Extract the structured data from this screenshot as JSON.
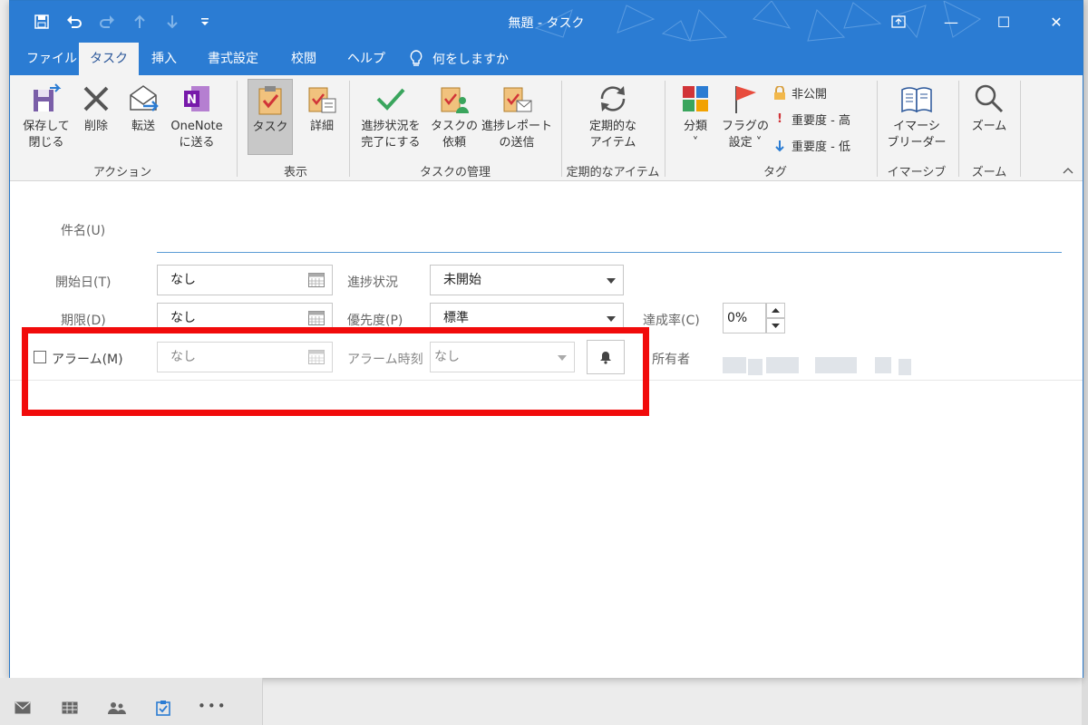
{
  "window": {
    "title": "無題 - タスク",
    "controls": {
      "restore_icon": "ribbon-display-icon",
      "minimize": "—",
      "maximize": "☐",
      "close": "✕"
    }
  },
  "qat": {
    "save_icon": "save-icon",
    "undo_icon": "undo-icon",
    "redo_icon": "redo-icon",
    "up_icon": "up-icon",
    "down_icon": "down-icon",
    "customize_icon": "customize-icon"
  },
  "tabs": [
    {
      "label": "ファイル"
    },
    {
      "label": "タスク"
    },
    {
      "label": "挿入"
    },
    {
      "label": "書式設定"
    },
    {
      "label": "校閲"
    },
    {
      "label": "ヘルプ"
    }
  ],
  "tell_me": "何をしますか",
  "ribbon": {
    "actions": {
      "save_close_1": "保存して",
      "save_close_2": "閉じる",
      "delete": "削除",
      "forward": "転送",
      "onenote_1": "OneNote",
      "onenote_2": "に送る",
      "group": "アクション"
    },
    "show": {
      "task": "タスク",
      "details": "詳細",
      "group": "表示"
    },
    "manage": {
      "complete_1": "進捗状況を",
      "complete_2": "完了にする",
      "assign_1": "タスクの",
      "assign_2": "依頼",
      "report_1": "進捗レポート",
      "report_2": "の送信",
      "group": "タスクの管理"
    },
    "recurrence": {
      "label_1": "定期的な",
      "label_2": "アイテム",
      "group": "定期的なアイテム"
    },
    "tags": {
      "categorize_1": "分類",
      "categorize_2": "˅",
      "flag_1": "フラグの",
      "flag_2": "設定 ˅",
      "private": "非公開",
      "high": "重要度 - 高",
      "low": "重要度 - 低",
      "group": "タグ"
    },
    "immersive": {
      "label_1": "イマーシ",
      "label_2": "ブリーダー",
      "group": "イマーシブ"
    },
    "zoom": {
      "label": "ズーム",
      "group": "ズーム"
    }
  },
  "form": {
    "subject_label": "件名(U)",
    "start_label": "開始日(T)",
    "start_value": "なし",
    "due_label": "期限(D)",
    "due_value": "なし",
    "status_label": "進捗状況",
    "status_value": "未開始",
    "priority_label": "優先度(P)",
    "priority_value": "標準",
    "complete_label": "達成率(C)",
    "complete_value": "0%",
    "reminder_label": "アラーム(M)",
    "reminder_date": "なし",
    "reminder_time_label": "アラーム時刻",
    "reminder_time": "なし",
    "owner_label": "所有者"
  },
  "bottom_nav": {
    "mail": "✉",
    "calendar": "▦",
    "people": "👥",
    "tasks": "☑",
    "more": "•••"
  }
}
